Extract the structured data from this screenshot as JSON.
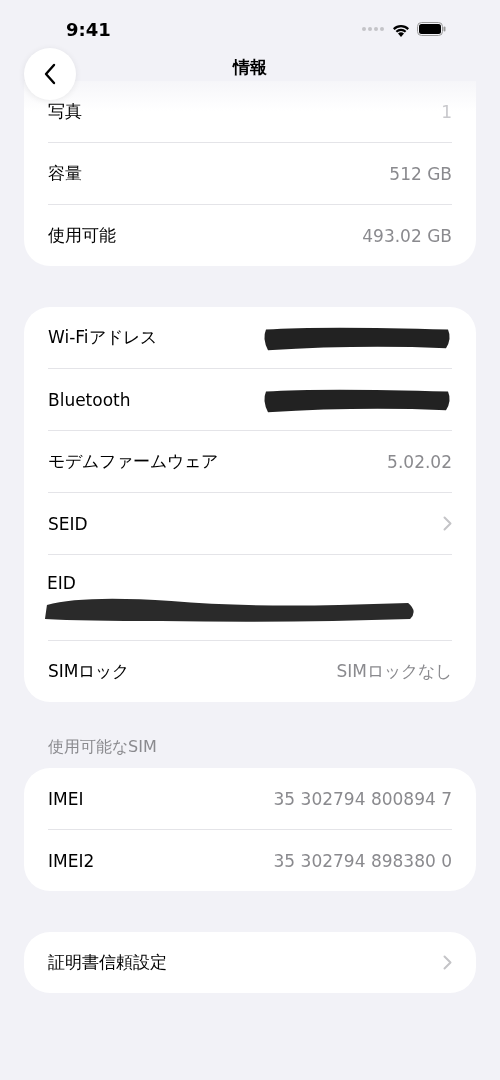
{
  "status_bar": {
    "time": "9:41"
  },
  "nav": {
    "title": "情報"
  },
  "groups": [
    {
      "rows": [
        {
          "label": "写真",
          "value": "1",
          "kind": "value",
          "faded": true
        },
        {
          "label": "容量",
          "value": "512 GB",
          "kind": "value",
          "faded": false
        },
        {
          "label": "使用可能",
          "value": "493.02 GB",
          "kind": "value",
          "faded": false
        }
      ]
    },
    {
      "rows": [
        {
          "label": "Wi-Fiアドレス",
          "kind": "redacted"
        },
        {
          "label": "Bluetooth",
          "kind": "redacted"
        },
        {
          "label": "モデムファームウェア",
          "value": "5.02.02",
          "kind": "value",
          "faded": false
        },
        {
          "label": "SEID",
          "kind": "chevron"
        },
        {
          "label": "EID",
          "kind": "redacted-below"
        },
        {
          "label": "SIMロック",
          "value": "SIMロックなし",
          "kind": "value",
          "faded": false
        }
      ]
    },
    {
      "header": "使用可能なSIM",
      "rows": [
        {
          "label": "IMEI",
          "value": "35 302794 800894 7",
          "kind": "value",
          "faded": false
        },
        {
          "label": "IMEI2",
          "value": "35 302794 898380 0",
          "kind": "value",
          "faded": false
        }
      ]
    },
    {
      "rows": [
        {
          "label": "証明書信頼設定",
          "kind": "chevron"
        }
      ]
    }
  ]
}
